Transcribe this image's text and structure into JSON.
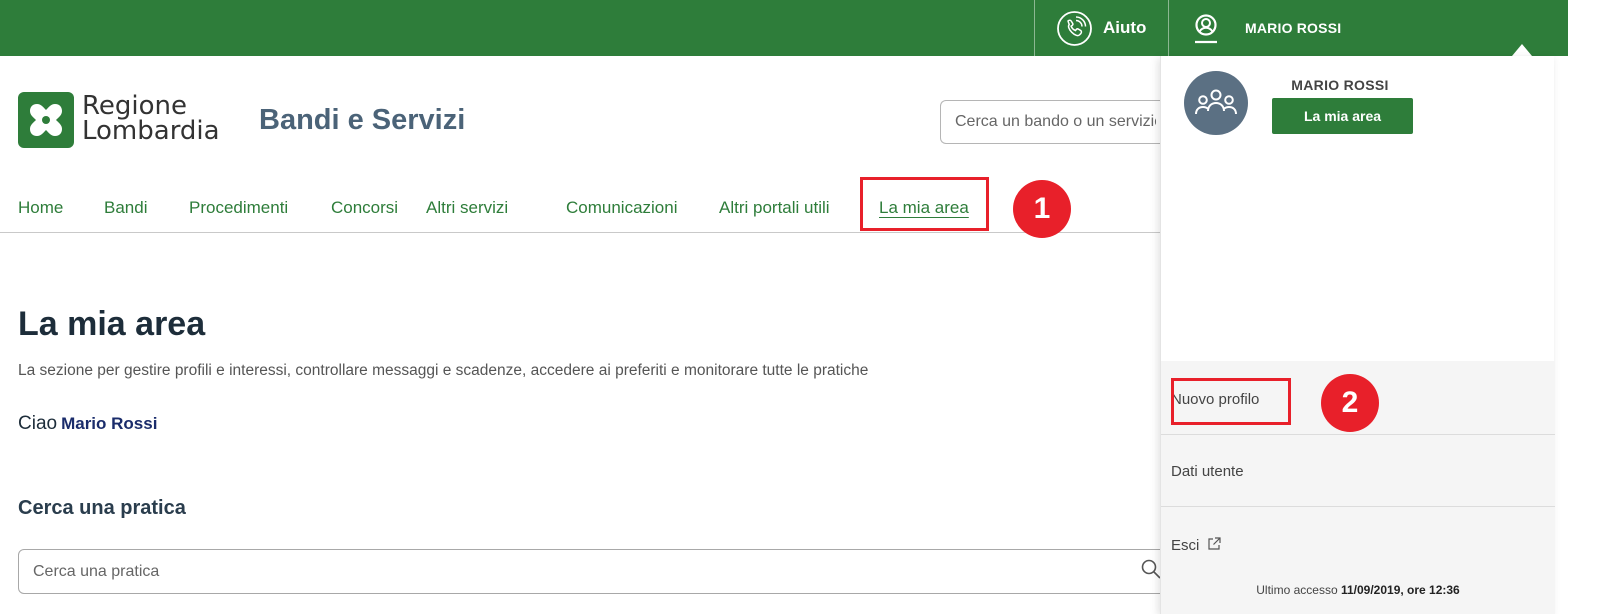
{
  "topbar": {
    "help_label": "Aiuto",
    "user_name": "MARIO ROSSI"
  },
  "header": {
    "logo_line1": "Regione",
    "logo_line2": "Lombardia",
    "site_title": "Bandi e Servizi",
    "search_placeholder": "Cerca un bando o un servizio"
  },
  "nav": {
    "items": [
      {
        "label": "Home"
      },
      {
        "label": "Bandi"
      },
      {
        "label": "Procedimenti"
      },
      {
        "label": "Concorsi"
      },
      {
        "label": "Altri servizi"
      },
      {
        "label": "Comunicazioni"
      },
      {
        "label": "Altri portali utili"
      },
      {
        "label": "La mia area"
      }
    ]
  },
  "callouts": {
    "first": "1",
    "second": "2"
  },
  "main": {
    "title": "La mia area",
    "description": "La sezione per gestire profili e interessi, controllare messaggi e scadenze, accedere ai preferiti e monitorare tutte le pratiche",
    "greeting": "Ciao",
    "greeting_name": "Mario Rossi",
    "search_section_title": "Cerca una pratica",
    "search_placeholder": "Cerca una pratica"
  },
  "user_panel": {
    "username": "MARIO ROSSI",
    "button_label": "La mia area",
    "menu": [
      {
        "label": "Nuovo profilo"
      },
      {
        "label": "Dati utente"
      },
      {
        "label": "Esci"
      }
    ],
    "last_access_label": "Ultimo accesso",
    "last_access_value": "11/09/2019, ore 12:36"
  },
  "colors": {
    "brand_green": "#2e7d3a",
    "highlight_red": "#e8202a",
    "title_slate": "#4b6378"
  },
  "icons": [
    "phone-help-icon",
    "user-circle-icon",
    "logo-mark-icon",
    "group-avatar-icon",
    "search-icon",
    "external-link-icon"
  ]
}
